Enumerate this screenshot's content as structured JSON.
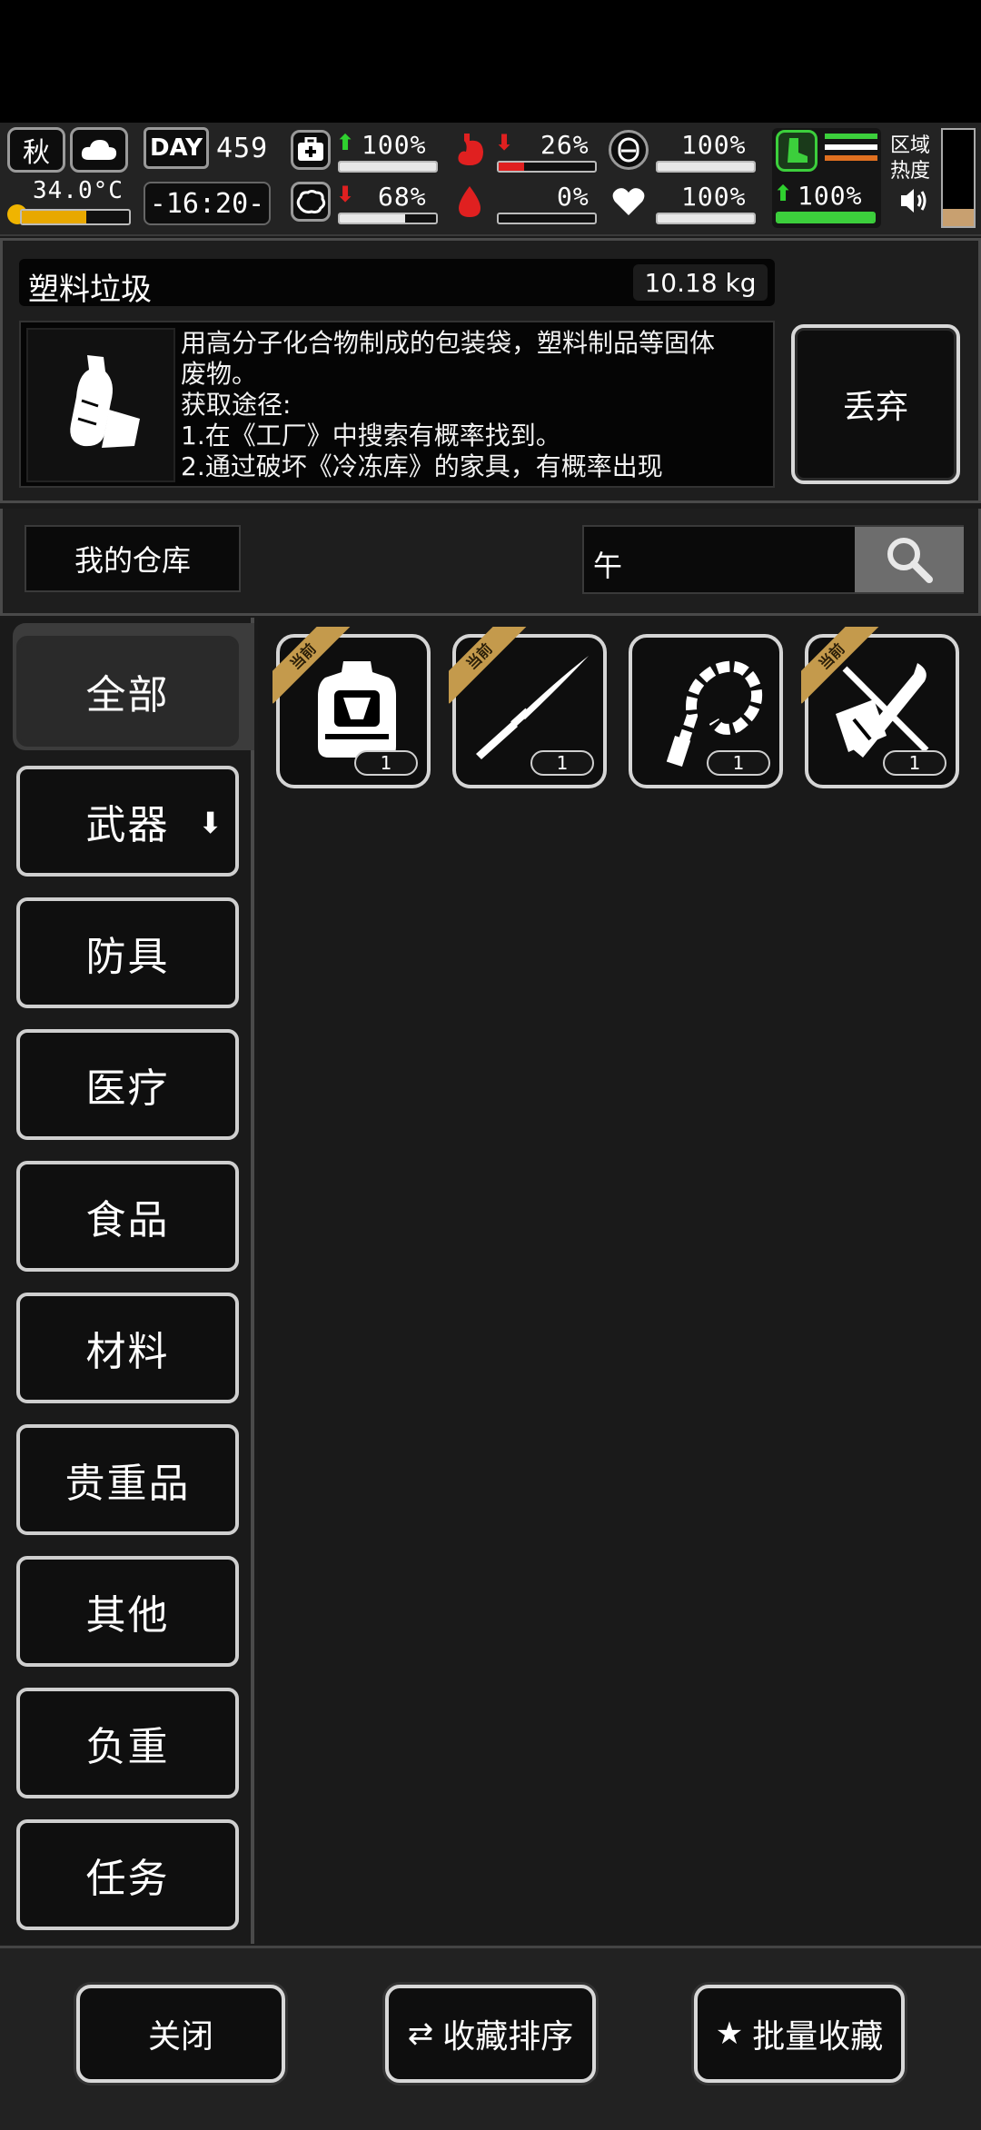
{
  "status": {
    "season": "秋",
    "temperature": "34.0°C",
    "day_label": "DAY",
    "day_number": "459",
    "clock": "-16:20-",
    "health_pct": "100%",
    "hunger_pct": "26%",
    "armor_pct": "100%",
    "stamina_pct": "100%",
    "mental_pct": "68%",
    "thirst_pct": "0%",
    "mood_pct": "100%",
    "zone_heat_label": "区域热度",
    "bar_levels": {
      "health": 1.0,
      "hunger": 0.26,
      "armor": 1.0,
      "stamina": 1.0,
      "mental": 0.68,
      "thirst": 0.0,
      "mood": 1.0
    },
    "colors": {
      "up": "#2fd12f",
      "down": "#e02020",
      "stamina": "#3ccf3c"
    }
  },
  "item": {
    "name": "塑料垃圾",
    "weight": "10.18 kg",
    "description_lines": [
      "用高分子化合物制成的包装袋，塑料制品等固体",
      "废物。",
      "获取途径:",
      "1.在《工厂》中搜索有概率找到。",
      "2.通过破坏《冷冻库》的家具，有概率出现"
    ],
    "discard_label": "丢弃"
  },
  "storage": {
    "title": "我的仓库",
    "search_value": "午"
  },
  "categories": [
    {
      "label": "全部"
    },
    {
      "label": "武器"
    },
    {
      "label": "防具"
    },
    {
      "label": "医疗"
    },
    {
      "label": "食品"
    },
    {
      "label": "材料"
    },
    {
      "label": "贵重品"
    },
    {
      "label": "其他"
    },
    {
      "label": "负重"
    },
    {
      "label": "任务"
    }
  ],
  "items": [
    {
      "icon": "backpack-icon",
      "badge": "当前",
      "count": "1"
    },
    {
      "icon": "katana-icon",
      "badge": "当前",
      "count": "1"
    },
    {
      "icon": "whip-icon",
      "badge": "",
      "count": "1"
    },
    {
      "icon": "crossbow-icon",
      "badge": "当前",
      "count": "1"
    }
  ],
  "footer": {
    "close_label": "关闭",
    "sort_label": "收藏排序",
    "batch_label": "批量收藏"
  }
}
